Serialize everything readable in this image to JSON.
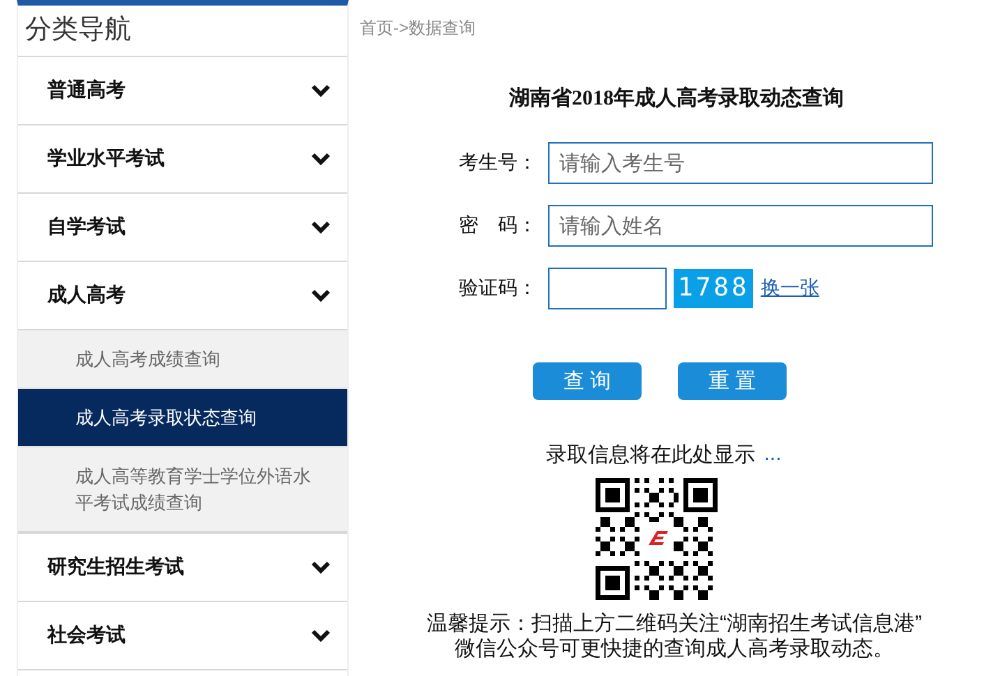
{
  "sidebar": {
    "title": "分类导航",
    "items": [
      {
        "label": "普通高考"
      },
      {
        "label": "学业水平考试"
      },
      {
        "label": "自学考试"
      },
      {
        "label": "成人高考",
        "expanded": true,
        "children": [
          {
            "label": "成人高考成绩查询",
            "selected": false
          },
          {
            "label": "成人高考录取状态查询",
            "selected": true
          },
          {
            "label": "成人高等教育学士学位外语水平考试成绩查询",
            "selected": false
          }
        ]
      },
      {
        "label": "研究生招生考试"
      },
      {
        "label": "社会考试"
      }
    ]
  },
  "breadcrumb": "首页->数据查询",
  "form": {
    "title": "湖南省2018年成人高考录取动态查询",
    "fields": [
      {
        "label": "考生号：",
        "placeholder": "请输入考生号"
      },
      {
        "label": "密　码：",
        "placeholder": "请输入姓名"
      }
    ],
    "captcha": {
      "label": "验证码：",
      "code": "1788",
      "refresh": "换一张"
    },
    "buttons": [
      "查 询",
      "重 置"
    ]
  },
  "result": {
    "text": "录取信息将在此处显示",
    "ellipsis": "..."
  },
  "tip": [
    "温馨提示：扫描上方二维码关注“湖南招生考试信息港”",
    "微信公众号可更快捷的查询成人高考录取动态。"
  ]
}
